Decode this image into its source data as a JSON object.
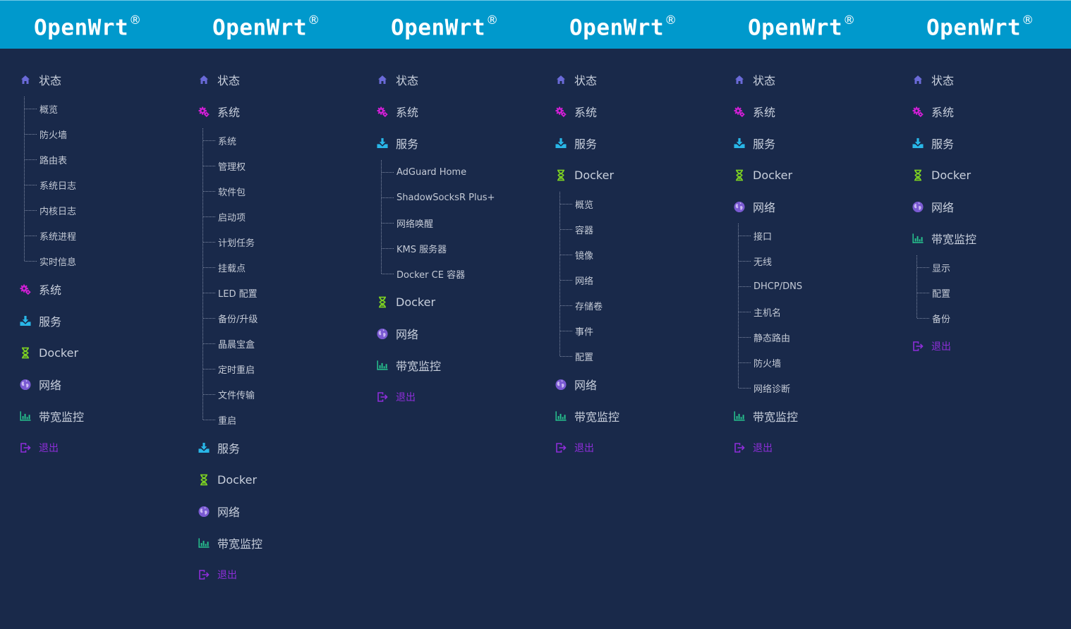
{
  "brand": {
    "name": "OpenWrt",
    "mark": "®"
  },
  "colors": {
    "header_bg": "#0099cc",
    "body_bg": "#19294a",
    "text": "#c8cfdc",
    "home_icon": "#6a6ad8",
    "gear_icon": "#d21fd6",
    "download_icon": "#29b7e8",
    "hourglass_icon": "#7ed321",
    "globe_icon": "#7a5ad2",
    "chart_icon": "#27c28e",
    "logout": "#8e2ed9"
  },
  "labels": {
    "status": "状态",
    "system": "系统",
    "services": "服务",
    "docker": "Docker",
    "network": "网络",
    "bandwidth": "带宽监控",
    "logout": "退出"
  },
  "columns": [
    {
      "expanded": "status",
      "submenu": [
        "概览",
        "防火墙",
        "路由表",
        "系统日志",
        "内核日志",
        "系统进程",
        "实时信息"
      ]
    },
    {
      "expanded": "system",
      "submenu": [
        "系统",
        "管理权",
        "软件包",
        "启动项",
        "计划任务",
        "挂载点",
        "LED 配置",
        "备份/升级",
        "晶晨宝盒",
        "定时重启",
        "文件传输",
        "重启"
      ]
    },
    {
      "expanded": "services",
      "submenu": [
        "AdGuard Home",
        "ShadowSocksR Plus+",
        "网络唤醒",
        "KMS 服务器",
        "Docker CE 容器"
      ]
    },
    {
      "expanded": "docker",
      "submenu": [
        "概览",
        "容器",
        "镜像",
        "网络",
        "存储卷",
        "事件",
        "配置"
      ]
    },
    {
      "expanded": "network",
      "submenu": [
        "接口",
        "无线",
        "DHCP/DNS",
        "主机名",
        "静态路由",
        "防火墙",
        "网络诊断"
      ]
    },
    {
      "expanded": "bandwidth",
      "submenu": [
        "显示",
        "配置",
        "备份"
      ]
    }
  ]
}
